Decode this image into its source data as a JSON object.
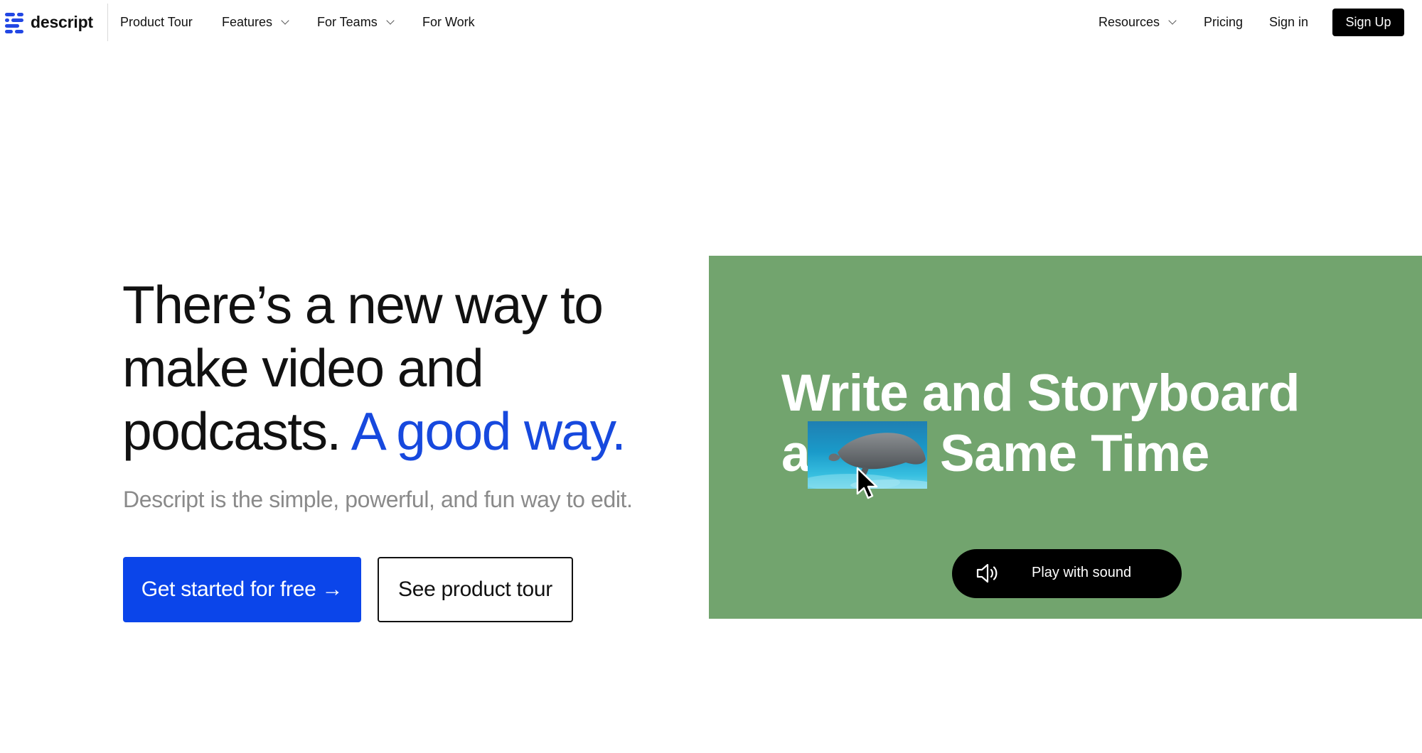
{
  "brand": {
    "name": "descript",
    "accent": "#1749de",
    "button_blue": "#0b45ea",
    "video_bg": "#72a46e"
  },
  "nav": {
    "left_items": [
      {
        "label": "Product Tour",
        "has_dropdown": false
      },
      {
        "label": "Features",
        "has_dropdown": true
      },
      {
        "label": "For Teams",
        "has_dropdown": true
      },
      {
        "label": "For Work",
        "has_dropdown": false
      }
    ],
    "right_items": [
      {
        "label": "Resources",
        "has_dropdown": true
      },
      {
        "label": "Pricing",
        "has_dropdown": false
      },
      {
        "label": "Sign in",
        "has_dropdown": false
      }
    ],
    "signup_label": "Sign Up"
  },
  "hero": {
    "headline_line1": "There’s a new way to",
    "headline_line2": "make video and",
    "headline_line3_plain": "podcasts.",
    "headline_line3_accent": "A good way.",
    "subhead": "Descript is the simple, powerful, and fun way to edit.",
    "cta_primary": "Get started for free →",
    "cta_secondary": "See product tour"
  },
  "video": {
    "line1": "Write and Storyboard",
    "line2_start": "a",
    "line2_end": "Same Time",
    "play_label": "Play with sound",
    "icons": [
      "speaker-icon",
      "mouse-cursor-icon",
      "manatee-thumbnail"
    ]
  }
}
